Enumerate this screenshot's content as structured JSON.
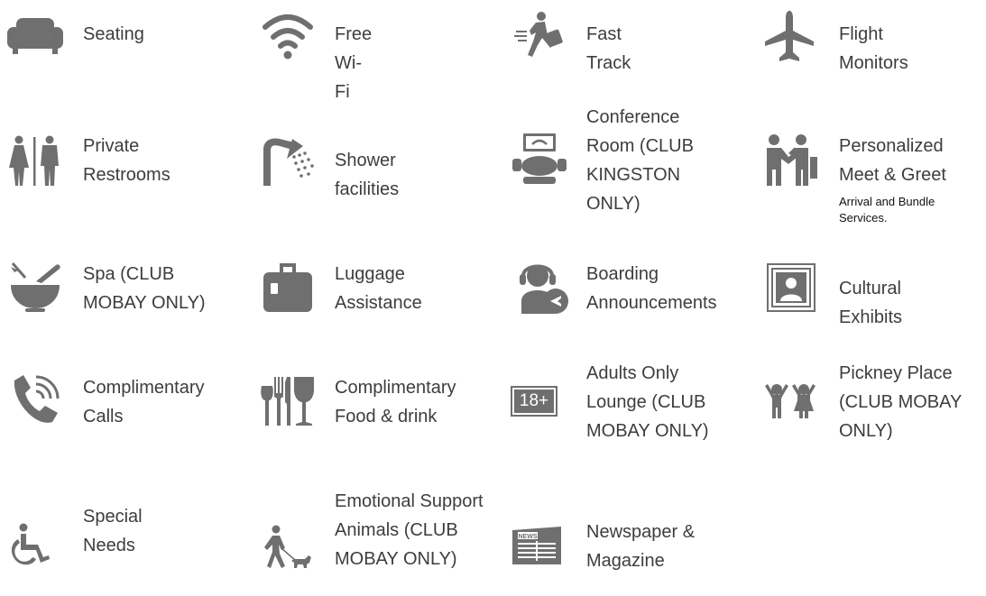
{
  "icon_color": "#6f6f6f",
  "amenities": [
    {
      "id": "seating",
      "icon": "sofa-icon",
      "label": "Seating"
    },
    {
      "id": "wifi",
      "icon": "wifi-icon",
      "label": "Free Wi-Fi"
    },
    {
      "id": "fast_track",
      "icon": "running-traveler-icon",
      "label": "Fast Track"
    },
    {
      "id": "flight_monitors",
      "icon": "airplane-icon",
      "label": "Flight Monitors"
    },
    {
      "id": "restrooms",
      "icon": "restroom-icon",
      "label": "Private Restrooms"
    },
    {
      "id": "shower",
      "icon": "shower-icon",
      "label": "Shower facilities"
    },
    {
      "id": "conference",
      "icon": "conference-table-icon",
      "label": "Conference Room (CLUB KINGSTON ONLY)"
    },
    {
      "id": "meet_greet",
      "icon": "handshake-icon",
      "label": "Personalized Meet & Greet",
      "sublabel": "Arrival and Bundle Services."
    },
    {
      "id": "spa",
      "icon": "mortar-pestle-icon",
      "label": "Spa (CLUB MOBAY ONLY)"
    },
    {
      "id": "luggage",
      "icon": "luggage-icon",
      "label": "Luggage Assistance"
    },
    {
      "id": "boarding",
      "icon": "headset-agent-icon",
      "label": "Boarding Announcements"
    },
    {
      "id": "exhibits",
      "icon": "framed-portrait-icon",
      "label": "Cultural Exhibits"
    },
    {
      "id": "calls",
      "icon": "phone-icon",
      "label": "Complimentary Calls"
    },
    {
      "id": "food",
      "icon": "cutlery-wine-icon",
      "label": "Complimentary Food & drink"
    },
    {
      "id": "adults",
      "icon": "age-18-plus-icon",
      "icon_text": "18+",
      "label": "Adults Only Lounge (CLUB MOBAY ONLY)"
    },
    {
      "id": "pickney",
      "icon": "children-icon",
      "label": "Pickney Place (CLUB MOBAY ONLY)"
    },
    {
      "id": "special_needs",
      "icon": "wheelchair-icon",
      "label": "Special Needs"
    },
    {
      "id": "esa",
      "icon": "person-walking-dog-icon",
      "label": "Emotional Support Animals (CLUB MOBAY ONLY)"
    },
    {
      "id": "newspaper",
      "icon": "newspaper-icon",
      "icon_text": "NEWS",
      "label": "Newspaper & Magazine"
    }
  ]
}
